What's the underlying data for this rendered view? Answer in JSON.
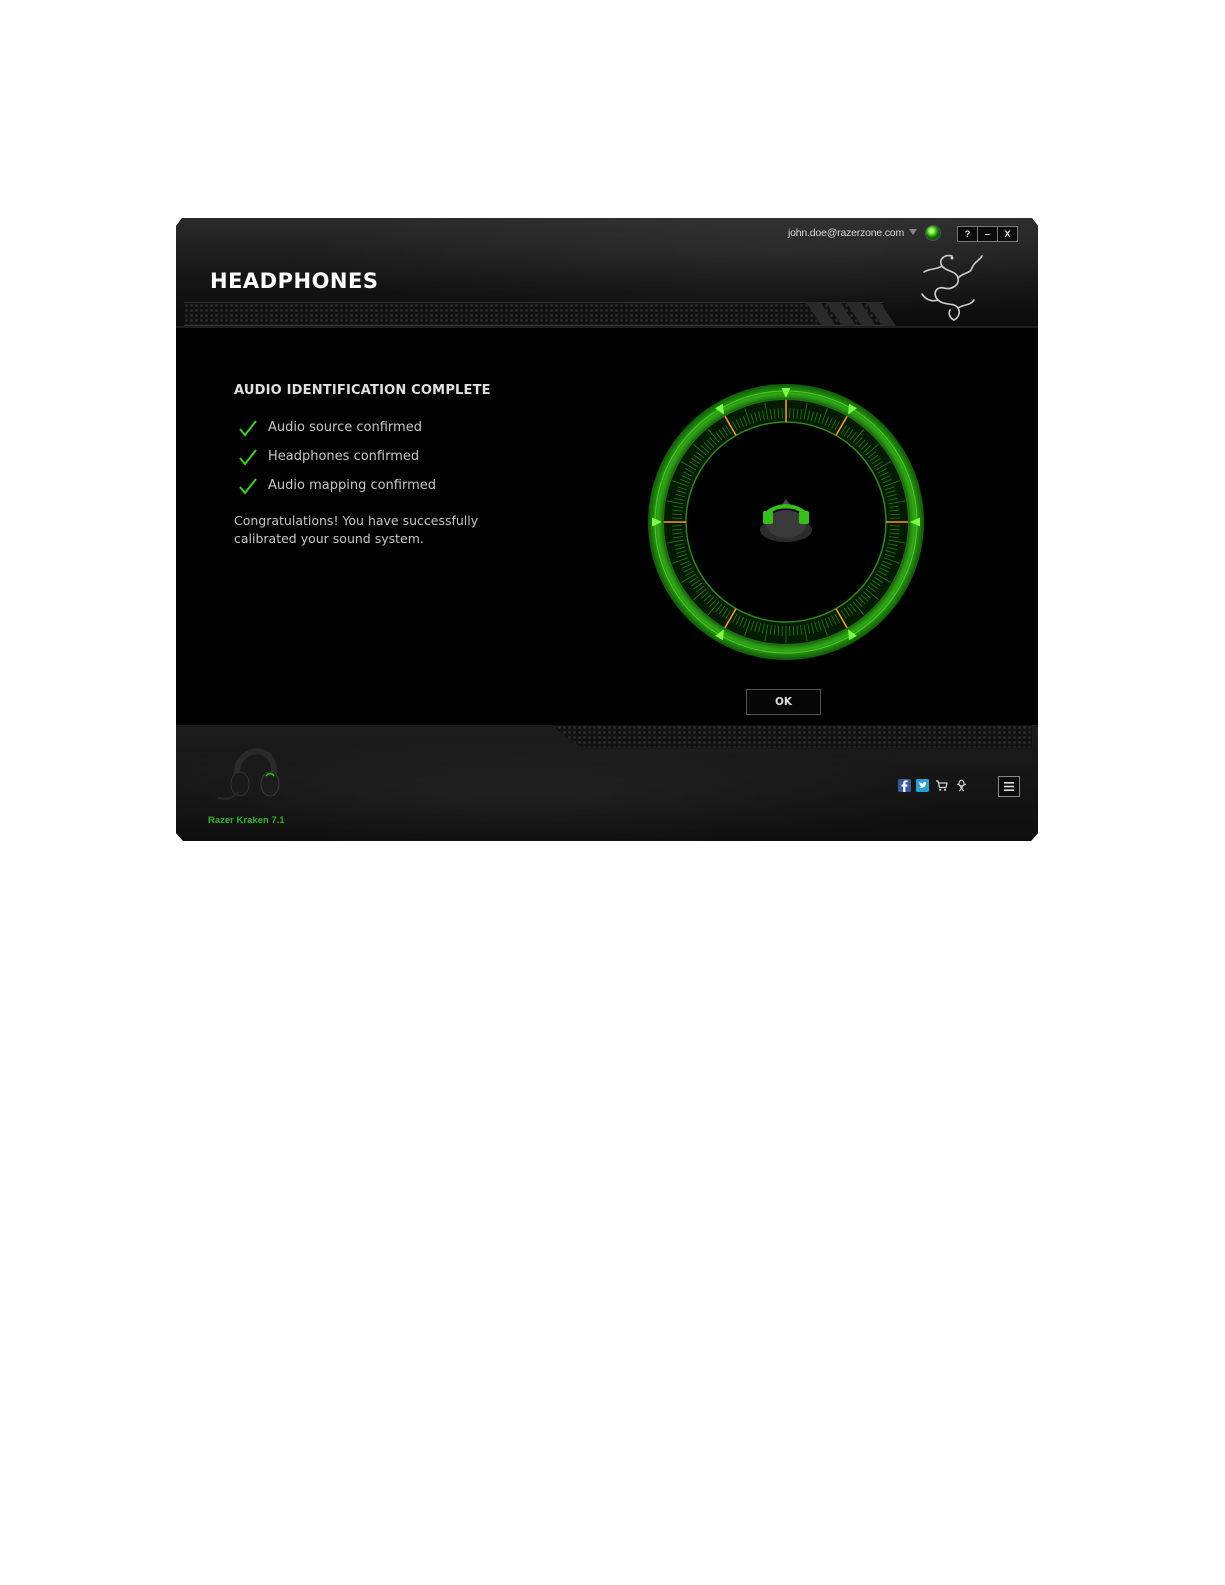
{
  "window": {
    "title": "HEADPHONES",
    "user_email": "john.doe@razerzone.com",
    "controls": {
      "help": "?",
      "minimize": "–",
      "close": "X"
    }
  },
  "content": {
    "heading": "AUDIO IDENTIFICATION COMPLETE",
    "checks": [
      {
        "label": "Audio source confirmed"
      },
      {
        "label": "Headphones confirmed"
      },
      {
        "label": "Audio mapping confirmed"
      }
    ],
    "message_line1": "Congratulations! You have successfully",
    "message_line2": "calibrated your  sound system.",
    "ok_label": "OK"
  },
  "footer": {
    "device_name": "Razer Kraken 7.1",
    "icons": [
      "facebook-icon",
      "twitter-icon",
      "cart-icon",
      "razer-icon",
      "menu-icon"
    ]
  },
  "colors": {
    "accent": "#3bd11a",
    "marker": "#ff9a1a",
    "background": "#000000"
  }
}
